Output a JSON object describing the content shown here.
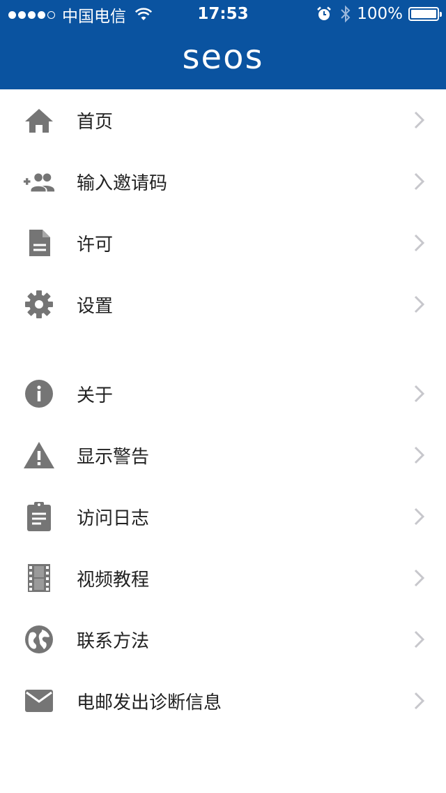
{
  "status_bar": {
    "carrier": "中国电信",
    "time": "17:53",
    "battery": "100%"
  },
  "header": {
    "logo": "seos",
    "background_color": "#0a53a0"
  },
  "menu_groups": [
    {
      "items": [
        {
          "label": "首页",
          "icon": "home-icon"
        },
        {
          "label": "输入邀请码",
          "icon": "add-person-icon"
        },
        {
          "label": "许可",
          "icon": "document-icon"
        },
        {
          "label": "设置",
          "icon": "gear-icon"
        }
      ]
    },
    {
      "items": [
        {
          "label": "关于",
          "icon": "info-icon"
        },
        {
          "label": "显示警告",
          "icon": "warning-icon"
        },
        {
          "label": "访问日志",
          "icon": "clipboard-icon"
        },
        {
          "label": "视频教程",
          "icon": "film-icon"
        },
        {
          "label": "联系方法",
          "icon": "globe-icon"
        },
        {
          "label": "电邮发出诊断信息",
          "icon": "mail-icon"
        }
      ]
    }
  ]
}
